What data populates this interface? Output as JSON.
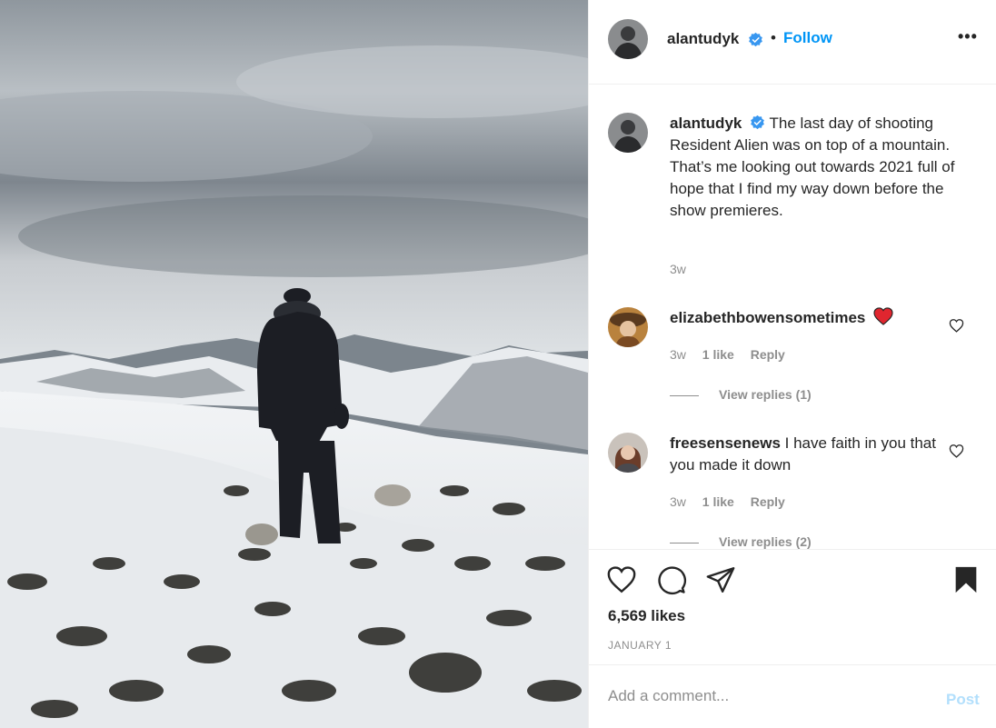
{
  "post": {
    "username": "alantudyk",
    "verified": true,
    "follow_label": "Follow",
    "separator": "•",
    "more_label": "•••",
    "photo_alt": "Man standing on snowy mountain top"
  },
  "caption": {
    "username": "alantudyk",
    "text": "The last day of shooting Resident Alien was on top of a mountain. That’s me looking out towards 2021 full of hope that I find my way down before the show premieres.",
    "time": "3w"
  },
  "comments": [
    {
      "username": "elizabethbowensometimes",
      "text": "",
      "time": "3w",
      "likes": "1 like",
      "reply_label": "Reply",
      "view_replies": "View replies (1)"
    },
    {
      "username": "freesensenews",
      "text": "I have faith in you that you made it down",
      "time": "3w",
      "likes": "1 like",
      "reply_label": "Reply",
      "view_replies": "View replies (2)"
    }
  ],
  "actions": {
    "likes": "6,569 likes",
    "date": "JANUARY 1"
  },
  "add_comment": {
    "placeholder": "Add a comment...",
    "post_label": "Post"
  },
  "colors": {
    "accent": "#0095f6",
    "post_disabled": "#b2dffc",
    "heart_emoji": "#e0262f",
    "secondary_text": "#8e8e8e"
  }
}
